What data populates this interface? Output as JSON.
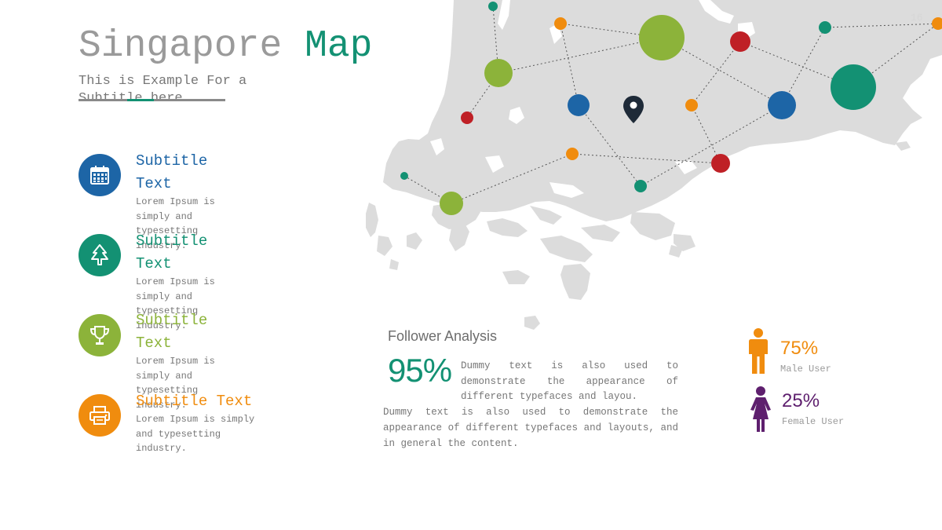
{
  "header": {
    "title_part1": "Singapore",
    "title_part2": "Map",
    "subtitle": "This is Example For a Subtitle here",
    "page_number": "16"
  },
  "features": [
    {
      "title": "Subtitle Text",
      "description": "Lorem Ipsum is simply and typesetting industry.",
      "color": "#1d65a6",
      "icon": "calendar-icon"
    },
    {
      "title": "Subtitle Text",
      "description": "Lorem Ipsum is simply and typesetting industry.",
      "color": "#139173",
      "icon": "tree-icon"
    },
    {
      "title": "Subtitle Text",
      "description": "Lorem Ipsum is simply and typesetting industry.",
      "color": "#8cb33a",
      "icon": "trophy-icon"
    },
    {
      "title": "Subtitle Text",
      "description": "Lorem Ipsum is simply and typesetting industry.",
      "color": "#f08c0e",
      "icon": "printer-icon"
    }
  ],
  "follower_analysis": {
    "title": "Follower Analysis",
    "percentage": "95%",
    "text_short": "Dummy text is also used to demonstrate the appearance of different typefaces and layou.",
    "text_long": "Dummy text is also used to demonstrate the appearance of different typefaces and layouts, and in general the content."
  },
  "users": {
    "male": {
      "percentage": "75%",
      "label": "Male User",
      "color": "#f08c0e",
      "icon": "male-user-icon"
    },
    "female": {
      "percentage": "25%",
      "label": "Female User",
      "color": "#5e1f6e",
      "icon": "female-user-icon"
    }
  },
  "map": {
    "land_color": "#dcdcdc",
    "marker_color": "#1e2a38",
    "point_colors": {
      "green": "#139173",
      "olive": "#8cb33a",
      "orange": "#f08c0e",
      "red": "#bf2026",
      "blue": "#1d65a6"
    }
  }
}
